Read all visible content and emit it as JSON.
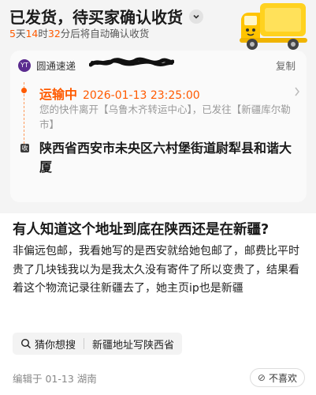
{
  "order_status": {
    "title": "已发货，待买家确认收货",
    "countdown": {
      "days": "5",
      "days_unit": "天",
      "hours": "14",
      "hours_unit": "时",
      "minutes": "32",
      "rest": "分后将自动确认收货"
    }
  },
  "logistics_card": {
    "courier_name": "圆通速递",
    "courier_logo_text": "YT",
    "copy_label": "复制",
    "status": "运输中",
    "time": "2026-01-13 23:25:00",
    "description": "您的快件离开【乌鲁木齐转运中心】，已发往【新疆库尔勒市】",
    "address_mark": "收",
    "address": "陕西省西安市未央区六村堡街道尉犁县和谐大厦"
  },
  "post": {
    "title": "有人知道这个地址到底在陕西还是在新疆?",
    "body": "非偏远包邮，我看她写的是西安就给她包邮了，邮费比平时贵了几块钱我以为是我太久没有寄件了所以变贵了，结果看着这个物流记录往新疆去了，她主页ip也是新疆",
    "tags": [
      {
        "label": "猜你想搜"
      },
      {
        "label": "新疆地址写陕西省"
      }
    ],
    "edited": "编辑于 01-13 湖南",
    "dislike_label": "不喜欢"
  },
  "colors": {
    "accent": "#ff5a00",
    "courier_brand": "#5b2c8f",
    "truck_yellow": "#ffd21f"
  },
  "icons": [
    "chevron-down-icon",
    "truck-illustration",
    "search-icon",
    "dislike-icon",
    "chevron-right-icon"
  ]
}
